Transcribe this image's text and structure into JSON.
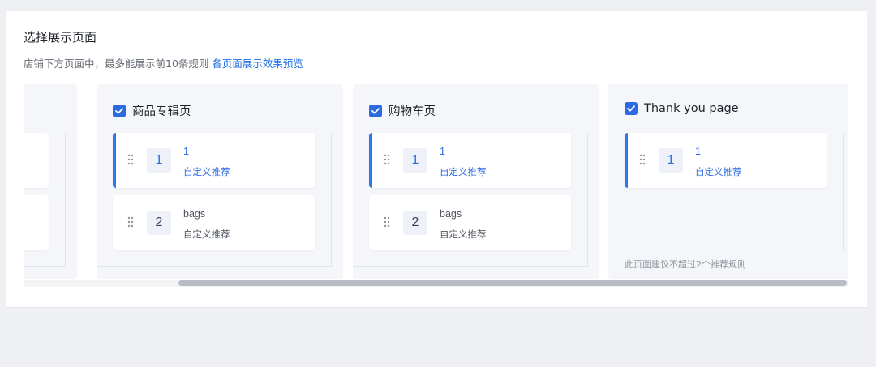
{
  "section": {
    "title": "选择展示页面",
    "subtitle": "店铺下方页面中，最多能展示前10条规则",
    "preview_link": "各页面展示效果预览"
  },
  "columns": [
    {
      "title": "商品专辑页",
      "checked": true,
      "cards": [
        {
          "index": "1",
          "name": "1",
          "type": "自定义推荐",
          "active": true
        },
        {
          "index": "2",
          "name": "bags",
          "type": "自定义推荐",
          "active": false
        }
      ]
    },
    {
      "title": "购物车页",
      "checked": true,
      "cards": [
        {
          "index": "1",
          "name": "1",
          "type": "自定义推荐",
          "active": true
        },
        {
          "index": "2",
          "name": "bags",
          "type": "自定义推荐",
          "active": false
        }
      ]
    },
    {
      "title": "Thank you page",
      "checked": true,
      "cards": [
        {
          "index": "1",
          "name": "1",
          "type": "自定义推荐",
          "active": true
        }
      ],
      "hint": "此页面建议不超过2个推荐规则"
    }
  ],
  "colors": {
    "accent": "#2b6ae3",
    "active_bar": "#2b7bf0",
    "column_bg": "#f5f6fa"
  },
  "icons": {
    "checkbox": "checkbox-checked-icon",
    "drag": "drag-handle-icon"
  }
}
